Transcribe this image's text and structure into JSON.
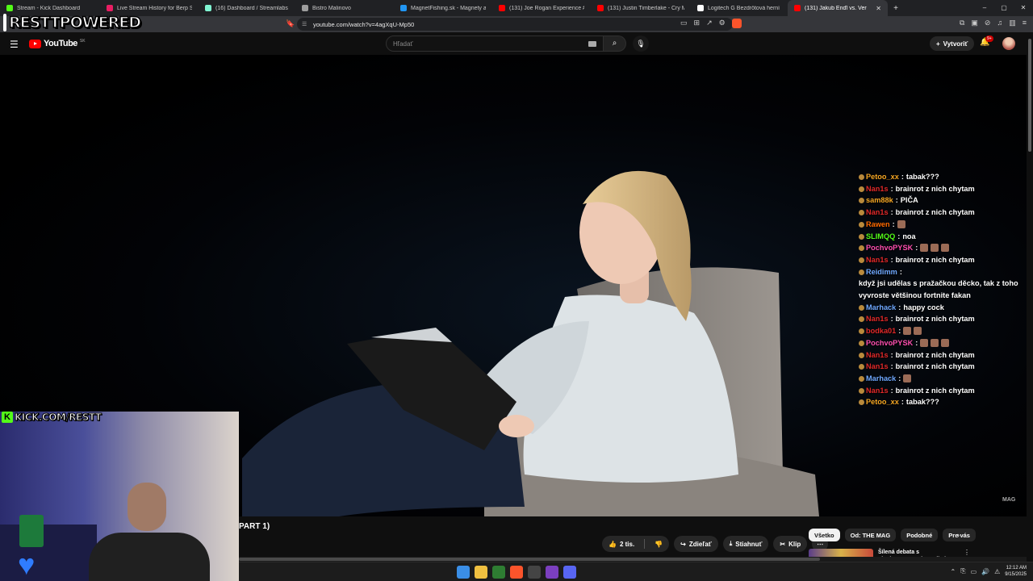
{
  "browser": {
    "tabs": [
      {
        "title": "Stream - Kick Dashboard",
        "favicon_color": "#53fc18",
        "active": false
      },
      {
        "title": "Live Stream History for Berp Shares",
        "favicon_color": "#e91e63",
        "active": false
      },
      {
        "title": "(16) Dashboard / Streamlabs",
        "favicon_color": "#80f5d2",
        "active": false
      },
      {
        "title": "Bistro Malinovo",
        "favicon_color": "#9e9e9e",
        "active": false
      },
      {
        "title": "MagnetFishing.sk - Magnety a laná p",
        "favicon_color": "#2196f3",
        "active": false
      },
      {
        "title": "(131) Joe Rogan Experience #2374 -",
        "favicon_color": "#ff0000",
        "active": false
      },
      {
        "title": "(131) Justin Timberlake - Cry Me A R",
        "favicon_color": "#ff0000",
        "active": false
      },
      {
        "title": "Logitech G Bezdrôtová herní myš 30",
        "favicon_color": "#ffffff",
        "active": false
      },
      {
        "title": "(131) Jakub Enďl vs. Veroniká",
        "favicon_color": "#ff0000",
        "active": true
      }
    ],
    "url": "youtube.com/watch?v=4agXqU-Mp50"
  },
  "stream_overlay": {
    "brand_text": "RESTTPOWERED",
    "kick_url": "KICK.COM/RESTT"
  },
  "youtube": {
    "logo_text": "YouTube",
    "country_code": "SK",
    "search_placeholder": "Hľadať",
    "create_label": "Vytvoriť",
    "notification_count": "9+",
    "video_watermark": "MAG",
    "video_title_fragment": "PART 1)",
    "like_count": "2 tis.",
    "share_label": "Zdieľať",
    "download_label": "Stiahnuť",
    "clip_label": "Klip",
    "chips": [
      "Všetko",
      "Od: THE MAG",
      "Podobné",
      "Pre vás"
    ],
    "recommended_title": "Šílená debata s plochozemcem (Pro silné povahy)"
  },
  "chat": [
    {
      "user": "Petoo_xx",
      "color": "#f5a623",
      "text": "tabak???",
      "emotes": 0
    },
    {
      "user": "Nan1s",
      "color": "#e02828",
      "text": "brainrot z nich chytam",
      "emotes": 0
    },
    {
      "user": "sam88k",
      "color": "#f5a623",
      "text": "PIČA",
      "emotes": 0
    },
    {
      "user": "Nan1s",
      "color": "#e02828",
      "text": "brainrot z nich chytam",
      "emotes": 0
    },
    {
      "user": "Rawen",
      "color": "#ff6a00",
      "text": "",
      "emotes": 1
    },
    {
      "user": "SLIMQQ",
      "color": "#53fc18",
      "text": "noa",
      "emotes": 0
    },
    {
      "user": "PochvoPYSK",
      "color": "#ff4fb0",
      "text": "",
      "emotes": 3
    },
    {
      "user": "Nan1s",
      "color": "#e02828",
      "text": "brainrot z nich chytam",
      "emotes": 0
    },
    {
      "user": "Reidimm",
      "color": "#6fa8ff",
      "text": "když jsi udělas s pražačkou děcko, tak z toho vyvroste většinou fortnite fakan",
      "emotes": 0
    },
    {
      "user": "Marhack",
      "color": "#6fa8ff",
      "text": "happy cock",
      "emotes": 0
    },
    {
      "user": "Nan1s",
      "color": "#e02828",
      "text": "brainrot z nich chytam",
      "emotes": 0
    },
    {
      "user": "bodka01",
      "color": "#e02828",
      "text": "",
      "emotes": 2
    },
    {
      "user": "PochvoPYSK",
      "color": "#ff4fb0",
      "text": "",
      "emotes": 3
    },
    {
      "user": "Nan1s",
      "color": "#e02828",
      "text": "brainrot z nich chytam",
      "emotes": 0
    },
    {
      "user": "Nan1s",
      "color": "#e02828",
      "text": "brainrot z nich chytam",
      "emotes": 0
    },
    {
      "user": "Marhack",
      "color": "#6fa8ff",
      "text": "",
      "emotes": 1
    },
    {
      "user": "Nan1s",
      "color": "#e02828",
      "text": "brainrot z nich chytam",
      "emotes": 0
    },
    {
      "user": "Petoo_xx",
      "color": "#f5a623",
      "text": "tabak???",
      "emotes": 0
    }
  ],
  "taskbar": {
    "time": "12:12 AM",
    "date": "9/15/2025"
  }
}
